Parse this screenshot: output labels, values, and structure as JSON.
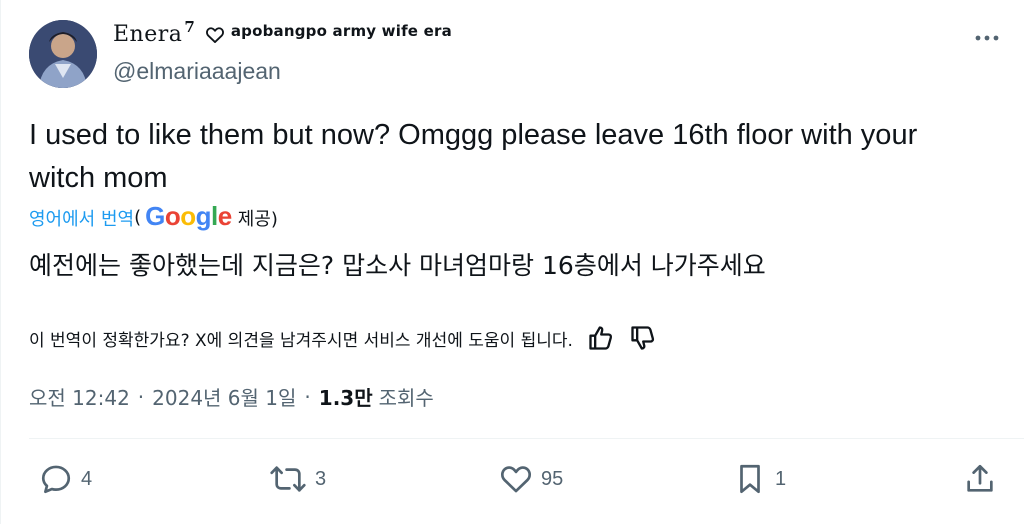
{
  "author": {
    "display_name": "Enera",
    "display_name_sup": "7",
    "display_name_suffix": "apobangpo army wife era",
    "handle": "@elmariaaajean",
    "avatar_icon": "user-avatar"
  },
  "tweet": {
    "text": "I used to like them but now? Omggg please leave 16th floor with your witch mom"
  },
  "translation": {
    "link_label": "영어에서 번역",
    "open_paren": "(",
    "provider": "Google",
    "provider_suffix": "제공)",
    "text": "예전에는 좋아했는데 지금은? 맙소사 마녀엄마랑 16층에서 나가주세요",
    "feedback_prompt": "이 번역이 정확한가요? X에 의견을 남겨주시면 서비스 개선에 도움이 됩니다."
  },
  "meta": {
    "time": "오전 12:42",
    "separator": "·",
    "date": "2024년 6월 1일",
    "separator2": "·",
    "views_count": "1.3만",
    "views_label": "조회수"
  },
  "actions": {
    "reply_count": "4",
    "retweet_count": "3",
    "like_count": "95",
    "bookmark_count": "1"
  },
  "colors": {
    "accent": "#1d9bf0",
    "muted": "#536471",
    "text": "#0f1419",
    "google_blue": "#4285f4",
    "google_red": "#ea4335",
    "google_yellow": "#fbbc05",
    "google_green": "#34a853"
  }
}
